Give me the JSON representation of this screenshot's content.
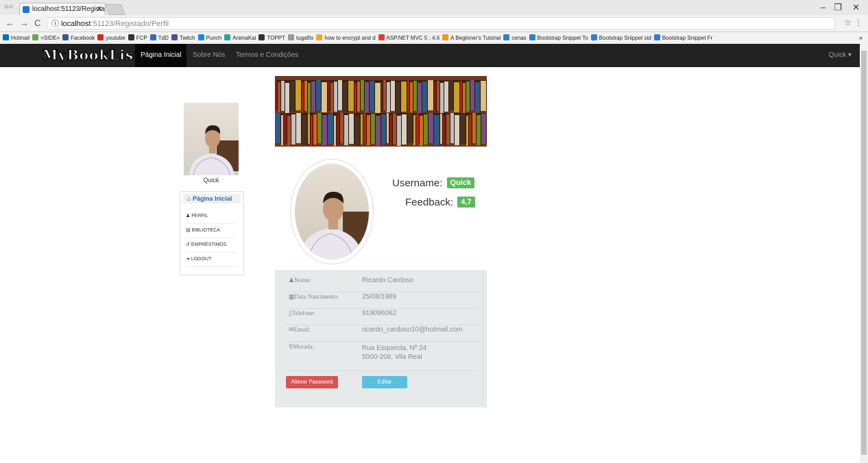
{
  "browser": {
    "tab_title": "localhost:51123/Registad",
    "url_host": "localhost",
    "url_path": ":51123/Registado/Perfil",
    "bookmarks": [
      {
        "label": "Hotmail",
        "color": "#0072c6"
      },
      {
        "label": "=SIDE=",
        "color": "#6aa84f"
      },
      {
        "label": "Facebook",
        "color": "#3b5998"
      },
      {
        "label": "youtube",
        "color": "#e62117"
      },
      {
        "label": "FCP",
        "color": "#333333"
      },
      {
        "label": "TdD",
        "color": "#2f6fb0"
      },
      {
        "label": "Twitch",
        "color": "#6441a5"
      },
      {
        "label": "Punch",
        "color": "#1e88e5"
      },
      {
        "label": "AnimaKai",
        "color": "#26a69a"
      },
      {
        "label": "TOPPT",
        "color": "#333333"
      },
      {
        "label": "tugafilx",
        "color": "#999999"
      },
      {
        "label": "how to encrypt and d",
        "color": "#f5a623"
      },
      {
        "label": "ASP.NET MVC 5 : 4.6",
        "color": "#e53935"
      },
      {
        "label": "A Beginner's Tutorial",
        "color": "#f39c12"
      },
      {
        "label": "cenas",
        "color": "#2d7fd3"
      },
      {
        "label": "Bootstrap Snippet To",
        "color": "#2d7fd3"
      },
      {
        "label": "Bootstrap Snippet sid",
        "color": "#2d7fd3"
      },
      {
        "label": "Bootstrap Snippet Fr",
        "color": "#2d7fd3"
      }
    ],
    "bookmarks_more": "»"
  },
  "navbar": {
    "brand": "MyBookList",
    "links": [
      "Página Inicial",
      "Sobre Nós",
      "Termos e Condições"
    ],
    "user_menu": "Quick ▾"
  },
  "sidebar": {
    "name": "Quick",
    "heading": "Página Inicial",
    "items": [
      "PERFIL",
      "BIBLIOTECA",
      "EMPRÉSTIMOS",
      "LOGOUT"
    ]
  },
  "profile": {
    "username_label": "Username:",
    "username": "Quick",
    "feedback_label": "Feedback:",
    "feedback": "4,7",
    "fields": [
      {
        "label": "Nome:",
        "value": "Ricardo Cardoso",
        "icon": "user-icon"
      },
      {
        "label": "Data Nascimento:",
        "value": "25/08/1989",
        "icon": "calendar-icon"
      },
      {
        "label": "Telefone:",
        "value": "919096062",
        "icon": "phone-icon"
      },
      {
        "label": "Email:",
        "value": "ricardo_cardoso10@hotmail.com",
        "icon": "envelope-icon"
      }
    ],
    "address_label": "Morada:",
    "address_line1": "Rua Esquerda, Nº 24",
    "address_line2": "5000-208, Vila Real",
    "change_password": "Alterar Password",
    "edit": "Editar"
  }
}
